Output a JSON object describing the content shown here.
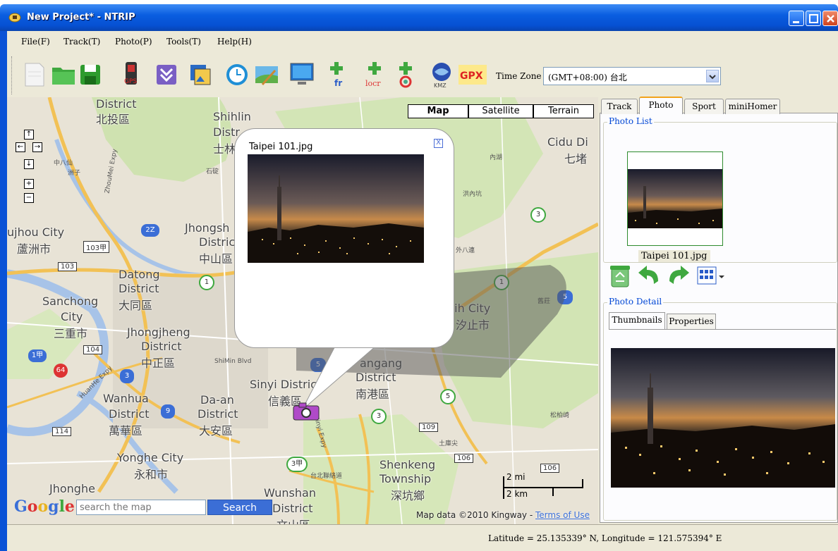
{
  "window": {
    "title": "New Project* - NTRIP"
  },
  "menu": {
    "items": [
      "File(F)",
      "Track(T)",
      "Photo(P)",
      "Tools(T)",
      "Help(H)"
    ]
  },
  "toolbar": {
    "icons": [
      "new-icon",
      "open-folder-icon",
      "save-icon",
      "gps-device-icon",
      "import-icon",
      "photo-album-icon",
      "clock-icon",
      "map-edit-icon",
      "monitor-icon",
      "add-fr-icon",
      "add-locr-icon",
      "add-picasa-icon",
      "kmz-icon",
      "gpx-icon"
    ],
    "gpx_label": "GPX",
    "fr_label": "fr",
    "locr_label": "locr",
    "kmz_label": "KMZ",
    "timezone_label": "Time Zone",
    "timezone_value": "(GMT+08:00) 台北"
  },
  "map": {
    "types": [
      "Map",
      "Satellite",
      "Terrain"
    ],
    "selected_type": "Map",
    "nav": {
      "up": "↑",
      "left": "←",
      "right": "→",
      "down": "↓",
      "zoom_in": "+",
      "zoom_out": "−"
    },
    "labels": {
      "beitou_en": "District",
      "beitou_zh": "北投區",
      "shihlin": "Shihlin",
      "shihlin_d": "Distr",
      "shihlin_zh": "士林",
      "ciduo": "Cidu Di",
      "ciduo_zh": "七堵",
      "luzhou": "ujhou City",
      "luzhou_zh": "蘆洲市",
      "zhongshan": "Jhongsh",
      "zhongshan_d": "Distric",
      "zhongshan_zh": "中山區",
      "datong": "Datong",
      "datong_d": "District",
      "datong_zh": "大同區",
      "sanchong": "Sanchong",
      "sanchong_c": "City",
      "sanchong_zh": "三重市",
      "zhongzheng": "Jhongjheng",
      "zhongzheng_d": "District",
      "zhongzheng_zh": "中正區",
      "xinyi": "Sinyi District",
      "xinyi_zh": "信義區",
      "wanhua": "Wanhua",
      "wanhua_d": "District",
      "wanhua_zh": "萬華區",
      "daan": "Da-an",
      "daan_d": "District",
      "daan_zh": "大安區",
      "nangang": "angang",
      "nangang_d": "District",
      "nangang_zh": "南港區",
      "xizhi": "hih City",
      "xizhi_zh": "汐止市",
      "yonghe": "Yonghe City",
      "yonghe_zh": "永和市",
      "shenkeng": "Shenkeng",
      "shenkeng_t": "Township",
      "shenkeng_zh": "深坑鄉",
      "zhonghe": "Jhonghe",
      "wunshan": "Wunshan",
      "wunshan_d": "District",
      "wunshan_zh": "文山區",
      "xiaosu": "中八仙",
      "zhouzi": "洲子",
      "route_103": "103",
      "route_103a": "103甲",
      "route_104": "104",
      "route_114": "114",
      "route_109": "109",
      "route_106": "106",
      "route_106b": "106",
      "shield_1": "1",
      "shield_3": "3",
      "shield_5": "5",
      "shield_2z": "2Z",
      "shield_5b": "5",
      "shield_3a": "3甲",
      "shield_64": "64",
      "shield_9": "9",
      "shield_1a": "1甲",
      "shield_3b": "3",
      "shield_5c": "5",
      "shield_3c": "3",
      "shimin": "ShiMin Blvd",
      "xinyi_expy": "Xinyi Expy",
      "huanhe": "HuanHe Expy",
      "zhoumei": "ZhouMei Expy",
      "neihu": "內湖",
      "taipei_expy": "台北聯絡道",
      "shikang": "石碇",
      "tucheng": "土庫尖",
      "songbo": "松柏崎",
      "lanhu": "洪內坑",
      "waijiu": "外八連",
      "jiuqi": "舊莊"
    },
    "search_placeholder": "search the map",
    "search_button": "Search",
    "google": "Google",
    "copyright": "Map data ©2010 Kingway - ",
    "terms": "Terms of Use",
    "scale_mi": "2 mi",
    "scale_km": "2 km",
    "popup": {
      "title": "Taipei 101.jpg",
      "close": "X"
    }
  },
  "panel": {
    "tabs": [
      "Track",
      "Photo",
      "Sport",
      "miniHomer"
    ],
    "active_tab": "Photo",
    "photo_list_label": "Photo List",
    "thumbnail_caption": "Taipei 101.jpg",
    "photo_tools": [
      "recycle-bin-icon",
      "rotate-left-icon",
      "rotate-right-icon",
      "view-mode-icon"
    ],
    "photo_detail_label": "Photo Detail",
    "detail_tabs": [
      "Thumbnails",
      "Properties"
    ],
    "active_detail_tab": "Thumbnails"
  },
  "status": {
    "text": "Latitude = 25.135339° N, Longitude = 121.575394° E"
  },
  "colors": {
    "titlebar": "#0650d2",
    "chrome": "#ece9d8",
    "accent": "#f2a31b"
  }
}
